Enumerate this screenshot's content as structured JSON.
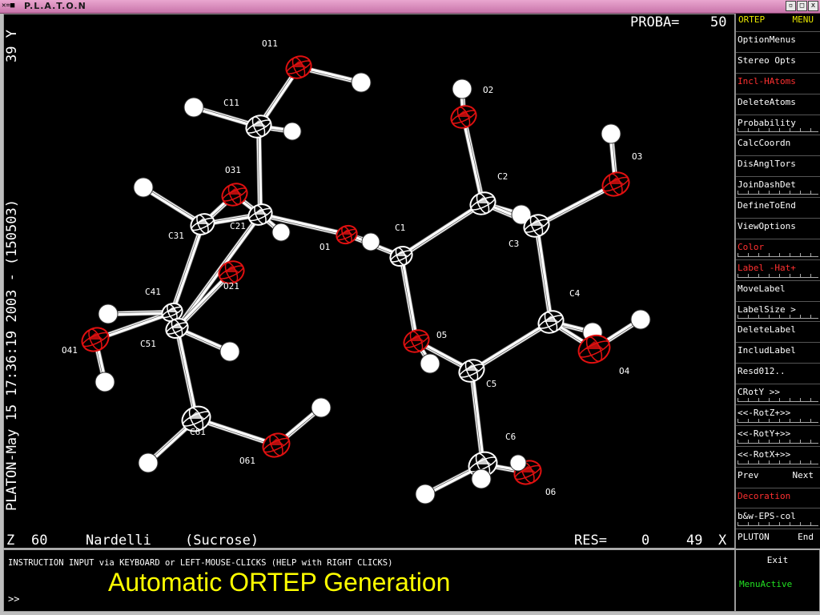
{
  "window": {
    "title": "P.L.A.T.O.N",
    "icon": "platon-icon",
    "btn_min": "▫",
    "btn_max": "□",
    "btn_close": "x"
  },
  "canvas": {
    "proba_label": "PROBA=",
    "proba_value": "50",
    "y_label": "39 Y",
    "vertical_stamp": "PLATON-May 15 17:36:19 2003 - (150503)",
    "z_label": "Z",
    "z_value": "60",
    "author": "Nardelli",
    "compound": "(Sucrose)",
    "res_label": "RES=",
    "res_value": "0",
    "x_value": "49",
    "x_label": "X"
  },
  "atom_labels": [
    "O11",
    "C11",
    "O31",
    "C21",
    "C31",
    "O21",
    "C41",
    "C51",
    "O41",
    "C61",
    "O61",
    "O1",
    "C1",
    "O2",
    "C2",
    "O3",
    "C3",
    "C4",
    "O4",
    "O5",
    "C5",
    "C6",
    "O6"
  ],
  "menu": {
    "header": [
      "ORTEP",
      "MENU"
    ],
    "items": [
      {
        "label": "OptionMenus",
        "color": "#ffffff"
      },
      {
        "label": "Stereo Opts",
        "color": "#ffffff"
      },
      {
        "label": "Incl-HAtoms",
        "color": "#ff3030"
      },
      {
        "label": "DeleteAtoms",
        "color": "#ffffff"
      },
      {
        "label": "Probability",
        "color": "#ffffff"
      },
      {
        "label": "CalcCoordn",
        "color": "#ffffff"
      },
      {
        "label": "DisAnglTors",
        "color": "#ffffff"
      },
      {
        "label": "JoinDashDet",
        "color": "#ffffff"
      },
      {
        "label": "DefineToEnd",
        "color": "#ffffff"
      },
      {
        "label": "ViewOptions",
        "color": "#ffffff"
      },
      {
        "label": "Color",
        "color": "#ff3030"
      },
      {
        "label": "Label -Hat+",
        "color": "#ff3030"
      },
      {
        "label": "MoveLabel",
        "color": "#ffffff"
      },
      {
        "label": "LabelSize >",
        "color": "#ffffff"
      },
      {
        "label": "DeleteLabel",
        "color": "#ffffff"
      },
      {
        "label": "IncludLabel",
        "color": "#ffffff"
      },
      {
        "label": "Resd012..",
        "color": "#ffffff"
      },
      {
        "label": "CRotY >>",
        "color": "#ffffff"
      },
      {
        "label": "<<-RotZ+>>",
        "color": "#ffffff"
      },
      {
        "label": "<<-RotY+>>",
        "color": "#ffffff"
      },
      {
        "label": "<<-RotX+>>",
        "color": "#ffffff"
      },
      {
        "label": "Prev",
        "label2": "Next",
        "color": "#ffffff"
      },
      {
        "label": "Decoration",
        "color": "#ff3030"
      },
      {
        "label": "b&w-EPS-col",
        "color": "#ffffff"
      },
      {
        "label": "PLUTON",
        "label2": "End",
        "color": "#ffffff"
      }
    ],
    "exit": "Exit",
    "status": "MenuActive"
  },
  "command": {
    "instruction": "INSTRUCTION INPUT via KEYBOARD or LEFT-MOUSE-CLICKS (HELP with RIGHT CLICKS)",
    "caption": "Automatic ORTEP Generation",
    "prompt": ">>"
  },
  "colors": {
    "oxygen": "#e01010",
    "carbon": "#ffffff",
    "caption": "#ffff00",
    "menu_red": "#ff3030",
    "status_green": "#22e022"
  }
}
